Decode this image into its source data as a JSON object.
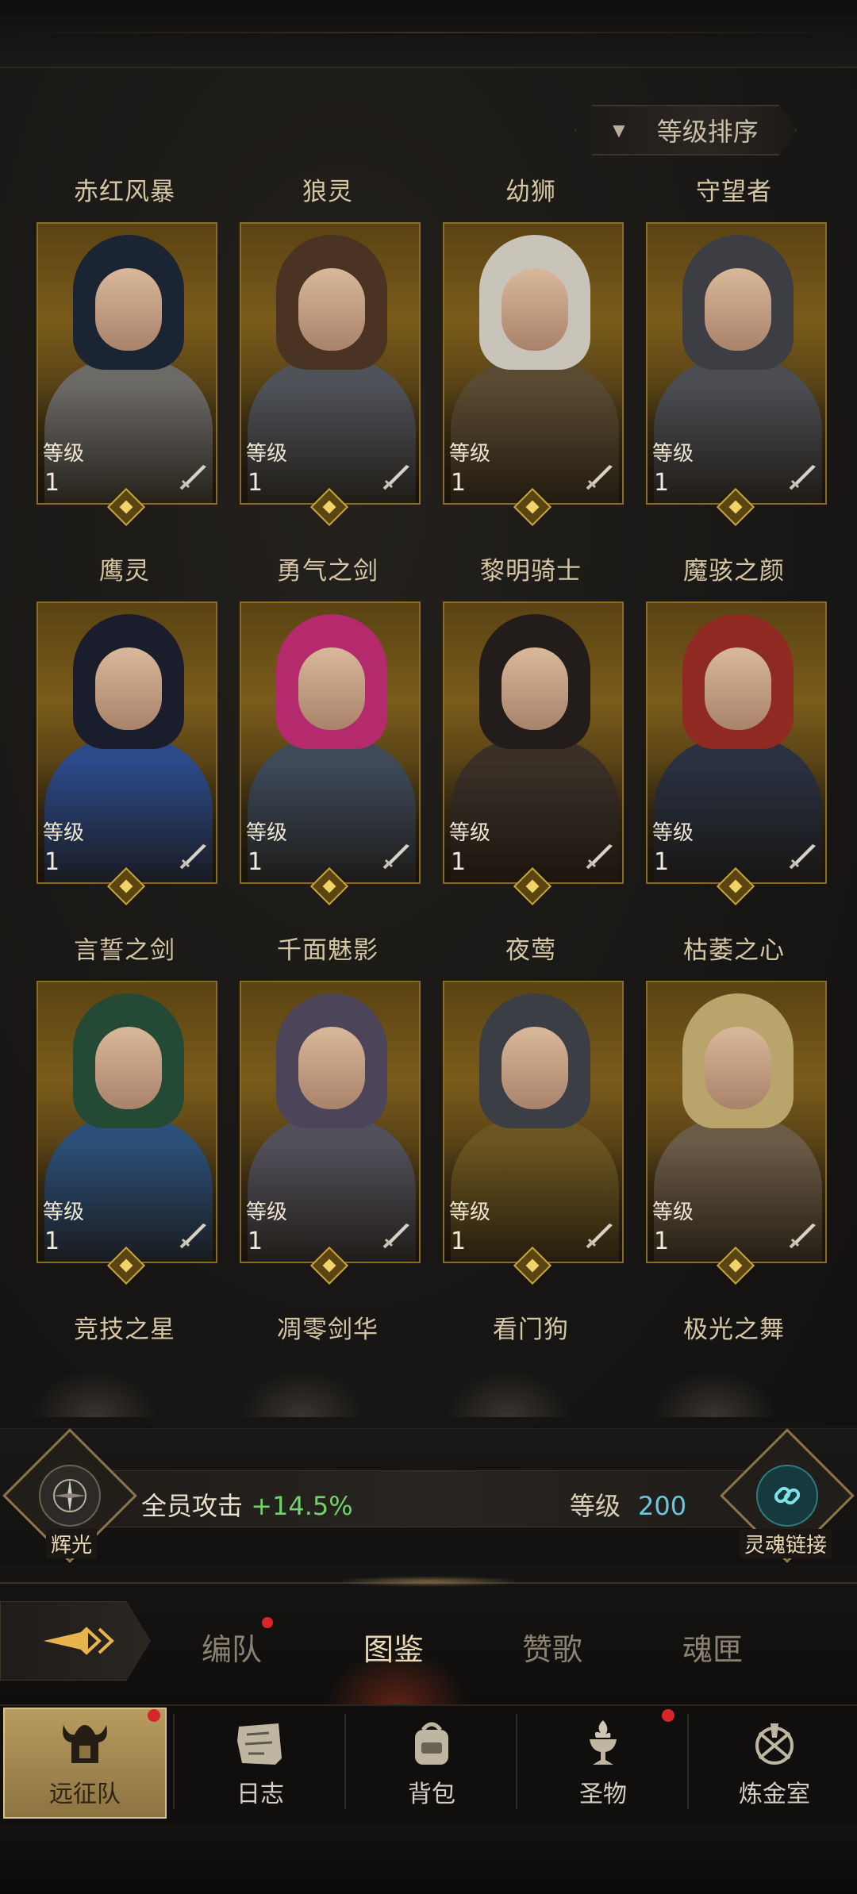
{
  "sort": {
    "label": "等级排序",
    "arrow": "▼"
  },
  "level_label": "等级",
  "heroes": [
    {
      "name": "赤红风暴",
      "level": "1",
      "hair": "#1b2433",
      "body": "#6c6a66"
    },
    {
      "name": "狼灵",
      "level": "1",
      "hair": "#4a3322",
      "body": "#4f5258"
    },
    {
      "name": "幼狮",
      "level": "1",
      "hair": "#c9c4ba",
      "body": "#5a4a32"
    },
    {
      "name": "守望者",
      "level": "1",
      "hair": "#3c3e43",
      "body": "#4b4d52"
    },
    {
      "name": "鹰灵",
      "level": "1",
      "hair": "#1a1e2c",
      "body": "#2c4a88"
    },
    {
      "name": "勇气之剑",
      "level": "1",
      "hair": "#b42a6c",
      "body": "#3e4a5a"
    },
    {
      "name": "黎明骑士",
      "level": "1",
      "hair": "#221d1a",
      "body": "#3a3028"
    },
    {
      "name": "魔骇之颜",
      "level": "1",
      "hair": "#8e2a22",
      "body": "#2a3142"
    },
    {
      "name": "言誓之剑",
      "level": "1",
      "hair": "#244a35",
      "body": "#2c4f78"
    },
    {
      "name": "千面魅影",
      "level": "1",
      "hair": "#4c4458",
      "body": "#52505a"
    },
    {
      "name": "夜莺",
      "level": "1",
      "hair": "#3c3e46",
      "body": "#6b5520"
    },
    {
      "name": "枯萎之心",
      "level": "1",
      "hair": "#b9a56c",
      "body": "#6b5a46"
    }
  ],
  "row4_names": [
    "竞技之星",
    "凋零剑华",
    "看门狗",
    "极光之舞"
  ],
  "stats": {
    "left_badge": "辉光",
    "attack_label": "全员攻击",
    "attack_value": "+14.5%",
    "level_label": "等级",
    "level_value": "200",
    "right_badge": "灵魂链接"
  },
  "tabs": [
    {
      "label": "编队",
      "active": false,
      "dot": true
    },
    {
      "label": "图鉴",
      "active": true,
      "dot": false
    },
    {
      "label": "赞歌",
      "active": false,
      "dot": false
    },
    {
      "label": "魂匣",
      "active": false,
      "dot": false
    }
  ],
  "nav": [
    {
      "label": "远征队",
      "icon": "helmet-icon",
      "active": true,
      "dot": true
    },
    {
      "label": "日志",
      "icon": "scroll-map-icon",
      "active": false,
      "dot": false
    },
    {
      "label": "背包",
      "icon": "backpack-icon",
      "active": false,
      "dot": false
    },
    {
      "label": "圣物",
      "icon": "chalice-flame-icon",
      "active": false,
      "dot": true
    },
    {
      "label": "炼金室",
      "icon": "alchemy-icon",
      "active": false,
      "dot": false
    }
  ],
  "colors": {
    "gold_frame": "#8a6a26",
    "green_stat": "#6fd36a",
    "cyan_stat": "#6cc6dc",
    "notification": "#d7262b"
  }
}
